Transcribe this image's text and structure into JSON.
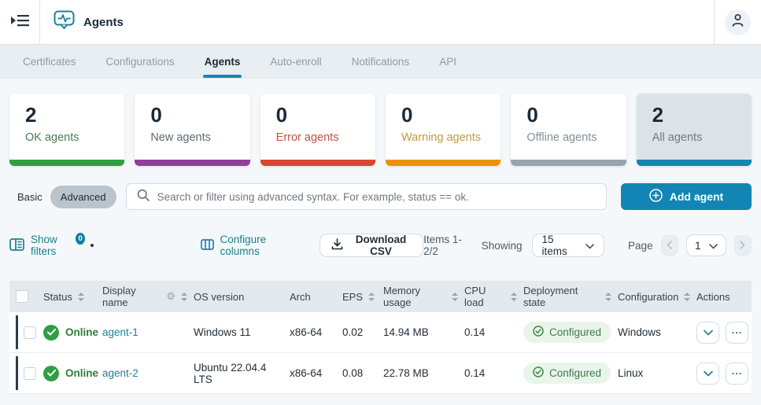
{
  "topbar": {
    "title": "Agents"
  },
  "tabs": [
    {
      "label": "Certificates",
      "active": false
    },
    {
      "label": "Configurations",
      "active": false
    },
    {
      "label": "Agents",
      "active": true
    },
    {
      "label": "Auto-enroll",
      "active": false
    },
    {
      "label": "Notifications",
      "active": false
    },
    {
      "label": "API",
      "active": false
    }
  ],
  "stat_cards": [
    {
      "value": "2",
      "label": "OK agents",
      "label_color": "#4a7c50",
      "bar_color": "#2f9e44",
      "selected": false
    },
    {
      "value": "0",
      "label": "New agents",
      "label_color": "#5f6a73",
      "bar_color": "#8f3f99",
      "selected": false
    },
    {
      "value": "0",
      "label": "Error agents",
      "label_color": "#bf5140",
      "bar_color": "#d7492f",
      "selected": false
    },
    {
      "value": "0",
      "label": "Warning agents",
      "label_color": "#c29a3a",
      "bar_color": "#ea9206",
      "selected": false
    },
    {
      "value": "0",
      "label": "Offline agents",
      "label_color": "#848f98",
      "bar_color": "#9aa3ac",
      "selected": false
    },
    {
      "value": "2",
      "label": "All agents",
      "label_color": "#6e7a84",
      "bar_color": "#1287ad",
      "selected": true
    }
  ],
  "search": {
    "mode_basic": "Basic",
    "mode_advanced": "Advanced",
    "placeholder": "Search or filter using advanced syntax. For example, status == ok.",
    "add_agent_label": "Add agent"
  },
  "toolbar": {
    "show_filters_label": "Show filters",
    "filters_badge": "0",
    "configure_columns_label": "Configure columns",
    "download_csv_label": "Download CSV",
    "items_range": "Items 1-2/2",
    "showing_label": "Showing",
    "page_size_value": "15 items",
    "page_label": "Page",
    "page_value": "1"
  },
  "table": {
    "columns": [
      {
        "label": "Status"
      },
      {
        "label": "Display name"
      },
      {
        "label": "OS version"
      },
      {
        "label": "Arch"
      },
      {
        "label": "EPS"
      },
      {
        "label": "Memory usage"
      },
      {
        "label": "CPU load"
      },
      {
        "label": "Deployment state"
      },
      {
        "label": "Configuration"
      },
      {
        "label": "Actions"
      }
    ],
    "rows": [
      {
        "status": "Online",
        "name": "agent-1",
        "os": "Windows 11",
        "arch": "x86-64",
        "eps": "0.02",
        "memory": "14.94 MB",
        "cpu": "0.14",
        "deployment": "Configured",
        "configuration": "Windows"
      },
      {
        "status": "Online",
        "name": "agent-2",
        "os": "Ubuntu 22.04.4 LTS",
        "arch": "x86-64",
        "eps": "0.08",
        "memory": "22.78 MB",
        "cpu": "0.14",
        "deployment": "Configured",
        "configuration": "Linux"
      }
    ]
  },
  "colors": {
    "accent_blue": "#1285b5",
    "tab_underline": "#1b87b0",
    "link_teal": "#17818f",
    "status_green": "#2f9e44",
    "selected_card_bg": "#dce3e7"
  }
}
